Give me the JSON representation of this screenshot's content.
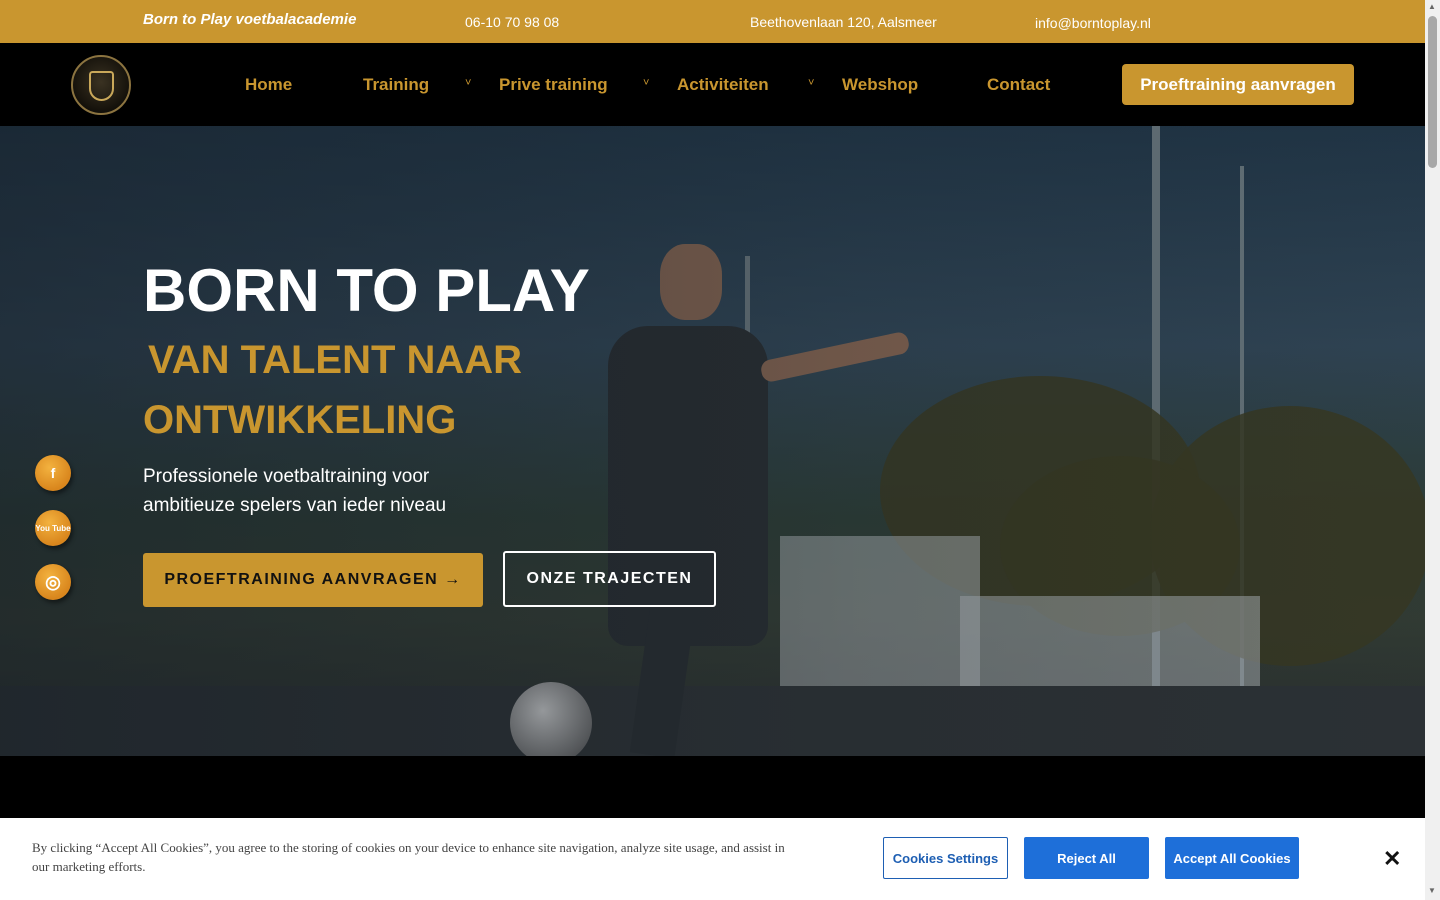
{
  "topbar": {
    "brand": "Born to Play voetbalacademie",
    "phone": "06-10 70 98 08",
    "address": "Beethovenlaan 120, Aalsmeer",
    "email": "info@borntoplay.nl"
  },
  "nav": {
    "items": [
      "Home",
      "Training",
      "Prive training",
      "Activiteiten",
      "Webshop",
      "Contact"
    ],
    "cta": "Proeftraining aanvragen",
    "chevron": "˅"
  },
  "hero": {
    "title": "BORN TO PLAY",
    "subtitle_line1": "VAN TALENT NAAR",
    "subtitle_line2": "ONTWIKKELING",
    "lead": "Professionele voetbaltraining voor ambitieuze spelers van ieder niveau",
    "primary_button": "PROEFTRAINING AANVRAGEN →",
    "secondary_button": "ONZE TRAJECTEN"
  },
  "social": {
    "facebook": "f",
    "youtube": "You Tube",
    "instagram": "◎"
  },
  "cookie": {
    "text": "By clicking “Accept All Cookies”, you agree to the storing of cookies on your device to enhance site navigation, analyze site usage, and assist in our marketing efforts.",
    "settings": "Cookies Settings",
    "reject": "Reject All",
    "accept": "Accept All Cookies",
    "close": "✕"
  },
  "colors": {
    "accent": "#c9962f",
    "navbar": "#000000",
    "cookie_button": "#1e6fd9"
  },
  "icons": [
    "logo-icon",
    "chevron-down-icon",
    "facebook-icon",
    "youtube-icon",
    "instagram-icon",
    "close-icon"
  ]
}
